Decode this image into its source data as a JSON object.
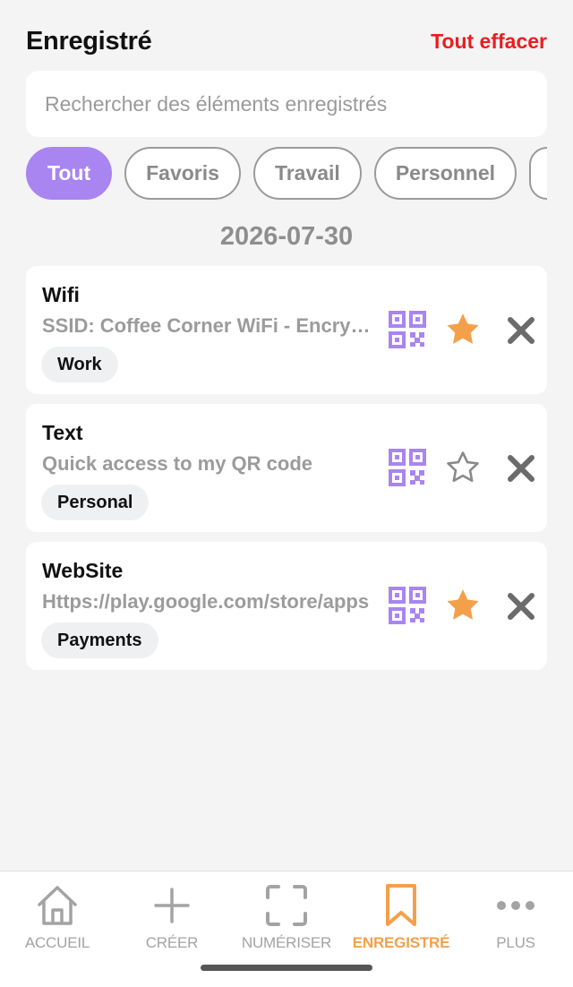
{
  "header": {
    "title": "Enregistré",
    "clear_all": "Tout effacer"
  },
  "search": {
    "placeholder": "Rechercher des éléments enregistrés",
    "value": ""
  },
  "filters": [
    "Tout",
    "Favoris",
    "Travail",
    "Personnel"
  ],
  "active_filter": "Tout",
  "section_date": "2026-07-30",
  "items": [
    {
      "title": "Wifi",
      "subtitle": "SSID: Coffee Corner WiFi - Encryption: WPA",
      "tag": "Work",
      "favorite": true,
      "star_icon": "star-filled-icon"
    },
    {
      "title": "Text",
      "subtitle": "Quick access to my QR code",
      "tag": "Personal",
      "favorite": false,
      "star_icon": "star-outline-icon"
    },
    {
      "title": "WebSite",
      "subtitle": "Https://play.google.com/store/apps",
      "tag": "Payments",
      "favorite": true,
      "star_icon": "star-filled-icon"
    }
  ],
  "bottom_nav": [
    {
      "label": "ACCUEIL",
      "icon": "home-icon",
      "active": false
    },
    {
      "label": "CRÉER",
      "icon": "plus-icon",
      "active": false
    },
    {
      "label": "NUMÉRISER",
      "icon": "scan-icon",
      "active": false
    },
    {
      "label": "ENREGISTRÉ",
      "icon": "bookmark-icon",
      "active": true
    },
    {
      "label": "PLUS",
      "icon": "more-icon",
      "active": false
    }
  ],
  "colors": {
    "accent": "#a985f2",
    "star": "#f4a04a",
    "danger": "#ea1d1d",
    "active_nav": "#f4a04a"
  }
}
